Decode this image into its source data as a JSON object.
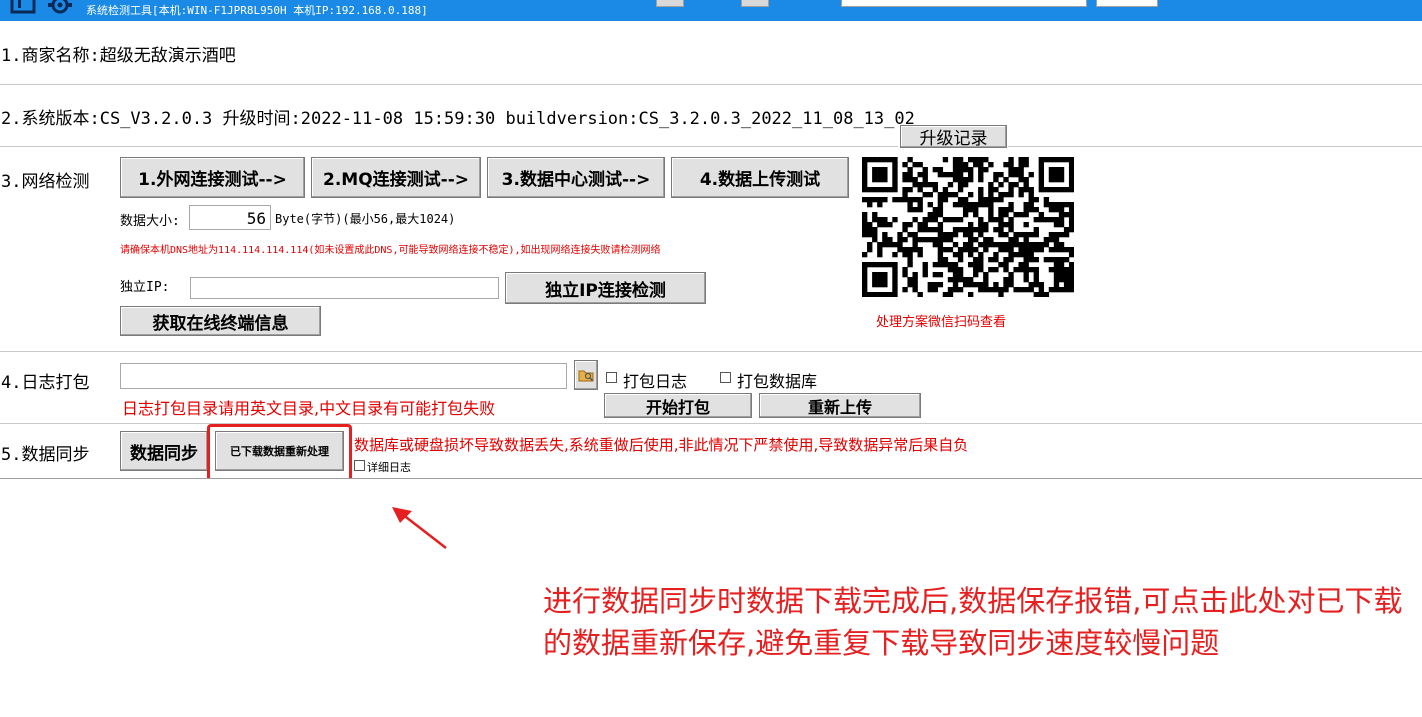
{
  "window": {
    "title": "系统检测工具[本机:WIN-F1JPR8L950H 本机IP:192.168.0.188]"
  },
  "merchant": {
    "label": "1.商家名称:超级无敌演示酒吧"
  },
  "version": {
    "label": "2.系统版本:CS_V3.2.0.3 升级时间:2022-11-08 15:59:30 buildversion:CS_3.2.0.3_2022_11_08_13_02",
    "upgrade_log_button": "升级记录"
  },
  "network": {
    "label": "3.网络检测",
    "test_buttons": [
      "1.外网连接测试-->",
      "2.MQ连接测试-->",
      "3.数据中心测试-->",
      "4.数据上传测试"
    ],
    "data_size_label": "数据大小:",
    "data_size_value": "56",
    "data_size_unit": "Byte(字节)(最小56,最大1024)",
    "dns_warning": "请确保本机DNS地址为114.114.114.114(如未设置成此DNS,可能导致网络连接不稳定),如出现网络连接失败请检测网络",
    "ip_label": "独立IP:",
    "ip_value": "",
    "ip_test_button": "独立IP连接检测",
    "online_terminal_button": "获取在线终端信息",
    "qr_caption": "处理方案微信扫码查看"
  },
  "log_pack": {
    "label": "4.日志打包",
    "path_value": "",
    "pack_log_checkbox": "打包日志",
    "pack_db_checkbox": "打包数据库",
    "path_warning": "日志打包目录请用英文目录,中文目录有可能打包失败",
    "start_button": "开始打包",
    "reupload_button": "重新上传"
  },
  "data_sync": {
    "label": "5.数据同步",
    "sync_button": "数据同步",
    "reprocess_button": "已下载数据重新处理",
    "warning": "数据库或硬盘损坏导致数据丢失,系统重做后使用,非此情况下严禁使用,导致数据异常后果自负",
    "detail_log_checkbox": "详细日志"
  },
  "annotation": {
    "text": "进行数据同步时数据下载完成后,数据保存报错,可点击此处对已下载的数据重新保存,避免重复下载导致同步速度较慢问题",
    "color": "#e52020"
  },
  "colors": {
    "titlebar": "#1a8ae6",
    "warning_red": "#e00000",
    "highlight_red": "#e52020"
  }
}
